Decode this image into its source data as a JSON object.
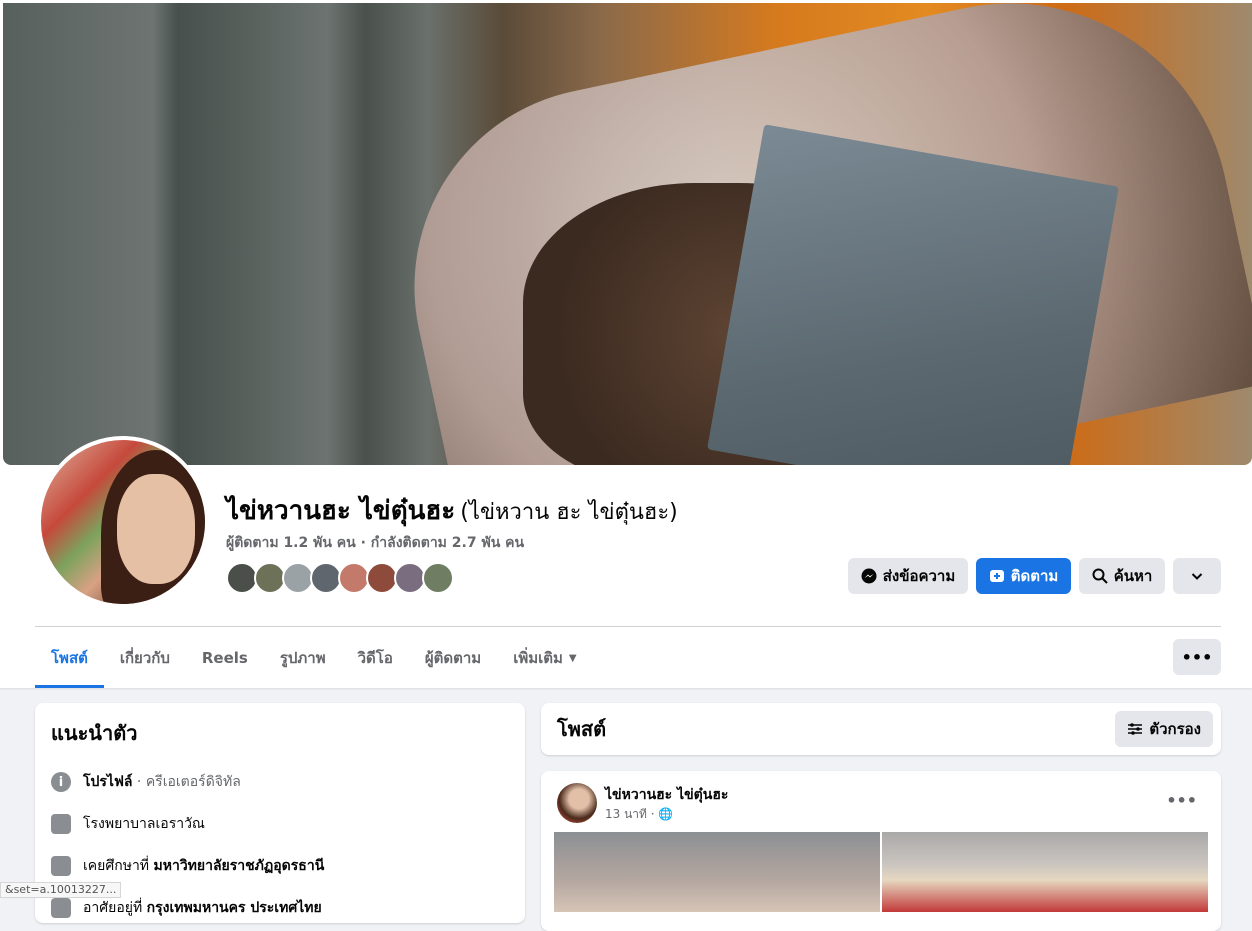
{
  "profile": {
    "name": "ไข่หวานฮะ ไข่ตุ๋นฮะ",
    "alt_name": "(ไข่หวาน ฮะ ไข่ตุ๋นฮะ)",
    "followers_text": "ผู้ติดตาม 1.2 พัน คน · กำลังติดตาม 2.7 พัน คน"
  },
  "actions": {
    "message": "ส่งข้อความ",
    "follow": "ติดตาม",
    "search": "ค้นหา"
  },
  "tabs": [
    "โพสต์",
    "เกี่ยวกับ",
    "Reels",
    "รูปภาพ",
    "วิดีโอ",
    "ผู้ติดตาม",
    "เพิ่มเติม"
  ],
  "intro": {
    "title": "แนะนำตัว",
    "profile_label": "โปรไฟล์",
    "profile_type": " · ครีเอเตอร์ดิจิทัล",
    "work": "โรงพยาบาลเอราวัณ",
    "study_prefix": "เคยศึกษาที่ ",
    "study_place": "มหาวิทยาลัยราชภัฏอุดรธานี",
    "live_prefix": "อาศัยอยู่ที่ ",
    "live_place": "กรุงเทพมหานคร ประเทศไทย"
  },
  "posts": {
    "title": "โพสต์",
    "filter": "ตัวกรอง",
    "post_author": "ไข่หวานฮะ ไข่ตุ๋นฮะ",
    "post_time": "13 นาที ·"
  },
  "status_url": "&set=a.10013227..."
}
